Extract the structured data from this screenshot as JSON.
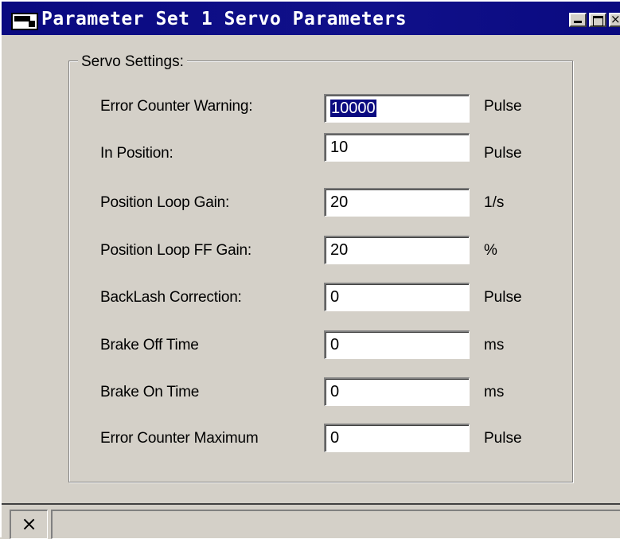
{
  "window": {
    "title": "Parameter Set 1 Servo Parameters",
    "buttons": {
      "close": "×"
    }
  },
  "group": {
    "legend": "Servo Settings:"
  },
  "fields": [
    {
      "label": "Error Counter Warning:",
      "value": "10000",
      "unit": "Pulse"
    },
    {
      "label": "In Position:",
      "value": "10",
      "unit": "Pulse"
    },
    {
      "label": "Position Loop Gain:",
      "value": "20",
      "unit": "1/s"
    },
    {
      "label": "Position Loop FF Gain:",
      "value": "20",
      "unit": "%"
    },
    {
      "label": "BackLash Correction:",
      "value": "0",
      "unit": "Pulse"
    },
    {
      "label": "Brake Off Time",
      "value": "0",
      "unit": "ms"
    },
    {
      "label": "Brake On Time",
      "value": "0",
      "unit": "ms"
    },
    {
      "label": "Error Counter Maximum",
      "value": "0",
      "unit": "Pulse"
    }
  ],
  "statusbar": {
    "icon_glyph": "×"
  },
  "colors": {
    "titlebar": "#0a0a80",
    "face": "#d4d0c8",
    "selection": "#0a0a80"
  }
}
